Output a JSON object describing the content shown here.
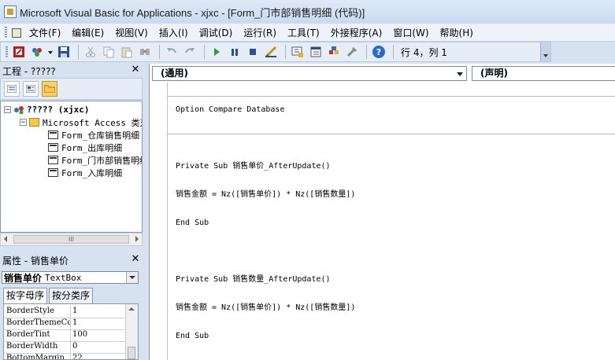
{
  "window": {
    "title": "Microsoft Visual Basic for Applications - xjxc - [Form_门市部销售明细 (代码)]"
  },
  "menubar": {
    "items": [
      "文件(F)",
      "编辑(E)",
      "视图(V)",
      "插入(I)",
      "调试(D)",
      "运行(R)",
      "工具(T)",
      "外接程序(A)",
      "窗口(W)",
      "帮助(H)"
    ]
  },
  "toolbar": {
    "status": "行 4，列 1"
  },
  "project_pane": {
    "title": "工程 - ?????",
    "close": "✕",
    "tree": {
      "root": "????? (xjxc)",
      "folder": "Microsoft Access 类对象",
      "items": [
        "Form_仓库销售明细",
        "Form_出库明细",
        "Form_门市部销售明细",
        "Form_入库明细"
      ]
    },
    "hscroll_label": "III"
  },
  "properties_pane": {
    "title": "属性 - 销售单价",
    "close": "✕",
    "object_name": "销售单价",
    "object_type": "TextBox",
    "tabs": [
      "按字母序",
      "按分类序"
    ],
    "rows": [
      {
        "name": "BorderStyle",
        "value": "1"
      },
      {
        "name": "BorderThemeColor",
        "value": "1"
      },
      {
        "name": "BorderTint",
        "value": "100"
      },
      {
        "name": "BorderWidth",
        "value": "0"
      },
      {
        "name": "BottomMargin",
        "value": "22"
      }
    ]
  },
  "code_window": {
    "object_combo": "(通用)",
    "proc_combo": "(声明)",
    "lines": [
      "Option Compare Database",
      "",
      "Private Sub 销售单价_AfterUpdate()",
      "销售金额 = Nz([销售单价]) * Nz([销售数量])",
      "End Sub",
      "",
      "Private Sub 销售数量_AfterUpdate()",
      "销售金额 = Nz([销售单价]) * Nz([销售数量])",
      "End Sub"
    ]
  }
}
